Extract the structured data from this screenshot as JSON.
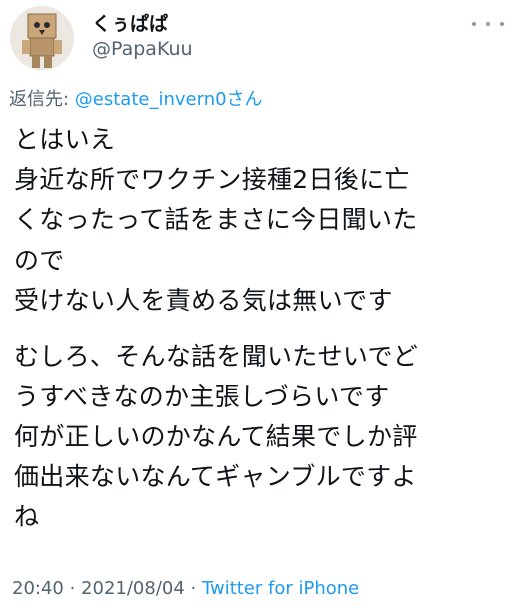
{
  "user": {
    "display_name": "くぅぱぱ",
    "handle": "@PapaKuu",
    "avatar_icon": "cardboard-robot-avatar-icon"
  },
  "reply": {
    "label": "返信先: ",
    "to_handle": "@estate_invern0さん"
  },
  "body": {
    "lines": [
      "とはいえ",
      "身近な所でワクチン接種2日後に亡",
      "くなったって話をまさに今日聞いた",
      "ので",
      "受けない人を責める気は無いです",
      "むしろ、そんな話を聞いたせいでど",
      "うすべきなのか主張しづらいです",
      "何が正しいのかなんて結果でしか評",
      "価出来ないなんてギャンブルですよ",
      "ね"
    ]
  },
  "meta": {
    "time_date": "20:40 · 2021/08/04 · ",
    "source": "Twitter for iPhone"
  },
  "colors": {
    "text": "#0f1419",
    "secondary": "#536471",
    "link": "#1d9bf0"
  }
}
